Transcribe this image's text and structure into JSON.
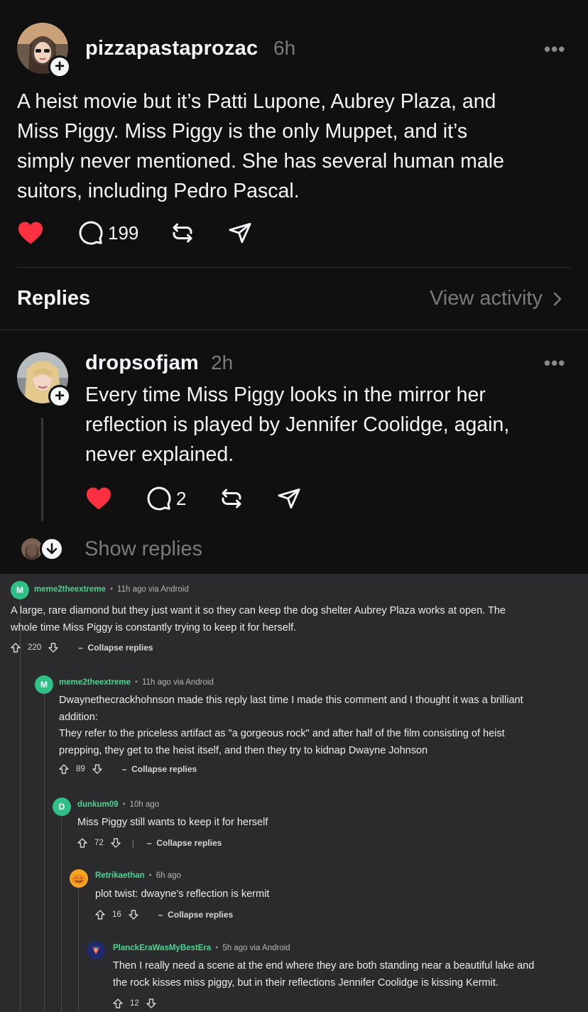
{
  "thread": {
    "post": {
      "username": "pizzapastaprozac",
      "time": "6h",
      "more_icon": "more-icon",
      "text_lines": [
        "A heist movie but it’s Patti Lupone, Aubrey Plaza, and",
        "Miss Piggy. Miss Piggy is the only Muppet, and it’s",
        "simply never mentioned. She has several human male",
        "suitors, including Pedro Pascal."
      ],
      "reply_count": "199"
    },
    "replies_header": {
      "label": "Replies",
      "view_activity": "View activity"
    },
    "reply": {
      "username": "dropsofjam",
      "time": "2h",
      "text_lines": [
        "Every time Miss Piggy looks in the mirror her",
        "reflection is played by Jennifer Coolidge, again,",
        "never explained."
      ],
      "reply_count": "2"
    },
    "show_replies": "Show replies",
    "colors": {
      "heart": "#ff3040",
      "background": "#101010"
    }
  },
  "reddit": {
    "comments": [
      {
        "username": "meme2theextreme",
        "meta": "11h ago via Android",
        "avatar_letter": "M",
        "avatar_color": "#2fbf87",
        "text_lines": [
          "A large, rare diamond but they just want it so they can keep the dog shelter Aubrey Plaza works at open. The",
          "whole time Miss Piggy is constantly trying to keep it for herself."
        ],
        "score": "220",
        "collapse": "Collapse replies"
      },
      {
        "username": "meme2theextreme",
        "meta": "11h ago via Android",
        "avatar_letter": "M",
        "avatar_color": "#2fbf87",
        "text_lines": [
          "Dwaynethecrackhohnson made this reply last time I made this comment and I thought it was a brilliant",
          "addition:",
          "They refer to the priceless artifact as \"a gorgeous rock\" and after half of the film consisting of heist",
          "prepping, they get to the heist itself, and then they try to kidnap Dwayne Johnson"
        ],
        "score": "89",
        "collapse": "Collapse replies"
      },
      {
        "username": "dunkum09",
        "meta": "10h ago",
        "avatar_letter": "D",
        "avatar_color": "#2fbf87",
        "text_lines": [
          "Miss Piggy still wants to keep it for herself"
        ],
        "score": "72",
        "collapse": "Collapse replies"
      },
      {
        "username": "Retrikaethan",
        "meta": "6h ago",
        "avatar_letter": "",
        "avatar_color": "#f5a623",
        "text_lines": [
          "plot twist: dwayne's reflection is kermit"
        ],
        "score": "16",
        "collapse": "Collapse replies"
      },
      {
        "username": "PlanckEraWasMyBestEra",
        "meta": "5h ago via Android",
        "avatar_letter": "",
        "avatar_color": "#1d2a6b",
        "text_lines": [
          "Then I really need a scene at the end where they are both standing near a beautiful lake and",
          "the rock kisses miss piggy, but in their reflections Jennifer Coolidge is kissing Kermit."
        ],
        "score": "12",
        "collapse": ""
      }
    ]
  }
}
